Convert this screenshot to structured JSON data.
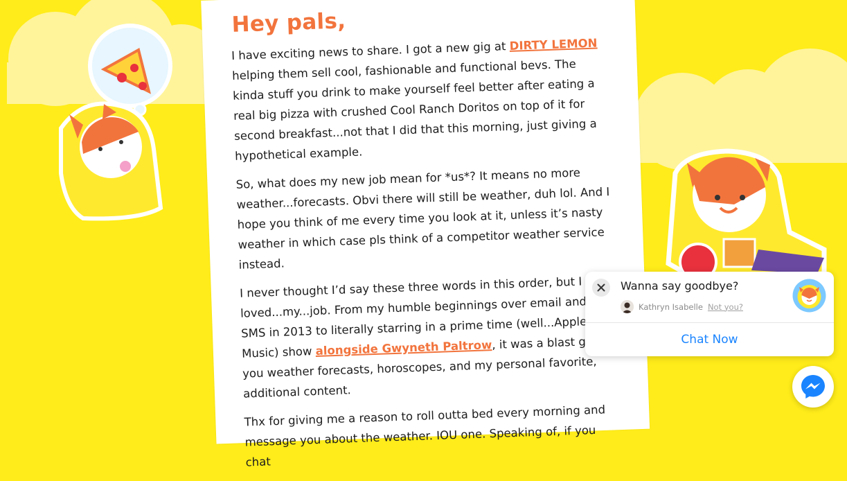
{
  "letter": {
    "greeting": "Hey pals,",
    "p1_before": "I have exciting news to share. I got a new gig at ",
    "p1_link": "DIRTY LEMON",
    "p1_after": " helping them sell cool, fashionable and functional bevs. The kinda stuff you drink to make yourself feel better after eating a real big pizza with crushed Cool Ranch Doritos on top of it for second breakfast...not that I did that this morning, just giving a hypothetical example.",
    "p2": "So, what does my new job mean for *us*? It means no more weather...forecasts. Obvi there will still be weather, duh lol. And I hope you think of me every time you look at it, unless it’s nasty weather in which case pls think of a competitor weather service instead.",
    "p3_before": "I never thought I’d say these three words in this order, but I loved...my...job. From my humble beginnings over email and SMS in 2013 to literally starring in a prime time (well...Apple Music) show ",
    "p3_link": "alongside Gwyneth Paltrow",
    "p3_after": ", it was a blast giving you weather forecasts, horoscopes, and my personal favorite, additional content.",
    "p4": "Thx for giving me a reason to roll outta bed every morning and message you about the weather. IOU one. Speaking of, if you chat"
  },
  "chat_popup": {
    "title": "Wanna say goodbye?",
    "user_name": "Kathryn Isabelle",
    "not_you": "Not you?",
    "cta": "Chat Now"
  },
  "icons": {
    "close": "close-icon",
    "messenger": "messenger-icon",
    "brand": "cat-mascot-icon"
  },
  "colors": {
    "background": "#ffec1a",
    "accent": "#f2743d",
    "link_blue": "#1a84ff"
  }
}
